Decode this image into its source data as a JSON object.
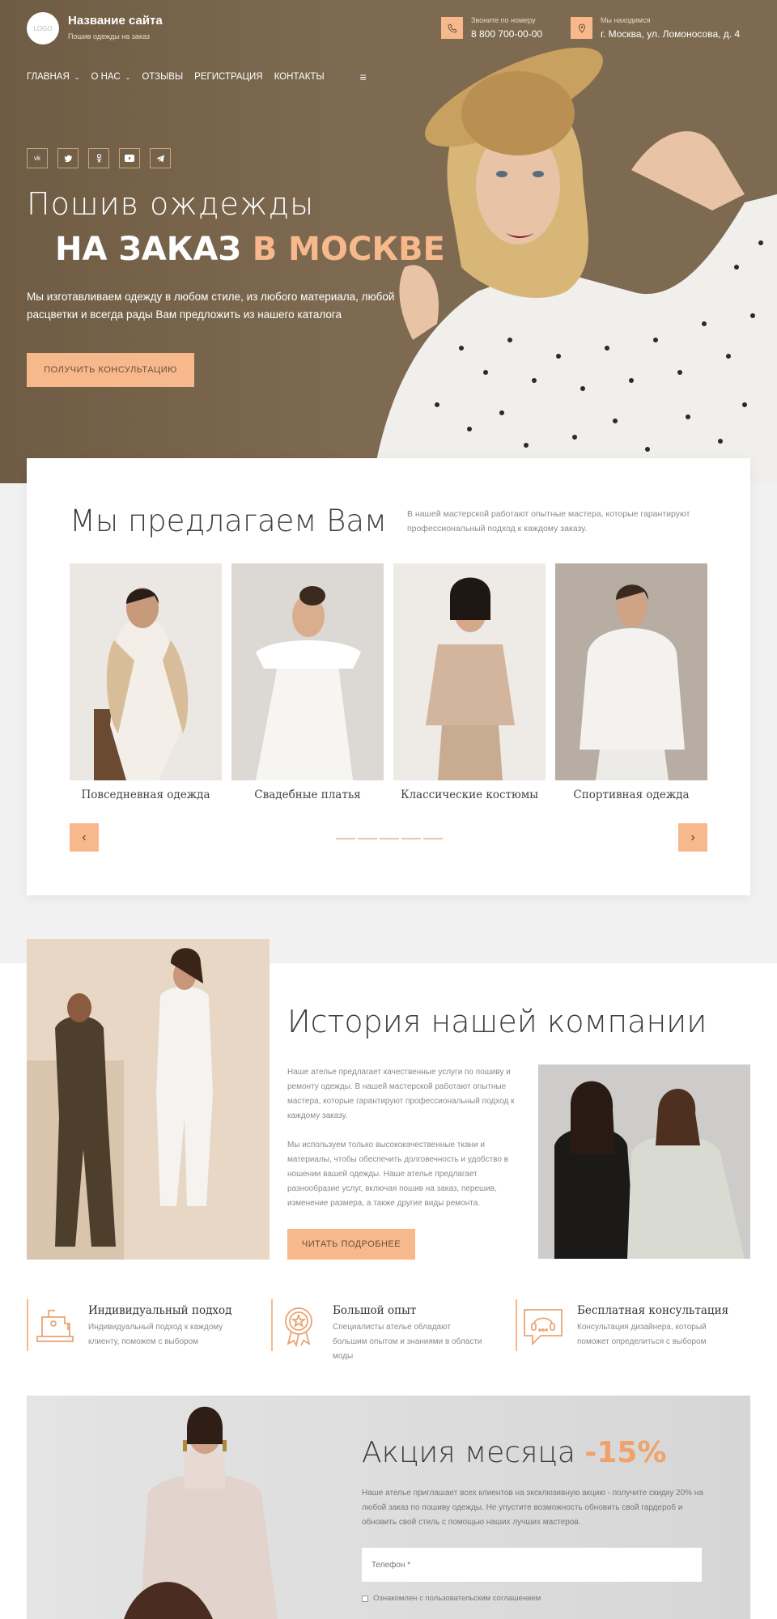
{
  "header": {
    "logo_text": "LOGO",
    "site_name": "Название сайта",
    "site_subtitle": "Пошив одежды на заказ",
    "phone_label": "Звоните по номеру",
    "phone": "8 800 700-00-00",
    "address_label": "Мы находимся",
    "address": "г. Москва, ул. Ломоносова, д. 4"
  },
  "nav": {
    "items": [
      {
        "label": "ГЛАВНАЯ",
        "dropdown": true
      },
      {
        "label": "О НАС",
        "dropdown": true
      },
      {
        "label": "ОТЗЫВЫ",
        "dropdown": false
      },
      {
        "label": "РЕГИСТРАЦИЯ",
        "dropdown": false
      },
      {
        "label": "КОНТАКТЫ",
        "dropdown": false
      }
    ],
    "menu_icon": "hamburger-icon"
  },
  "socials": [
    "VK",
    "Twitter",
    "Odnoklassniki",
    "YouTube",
    "Telegram"
  ],
  "hero": {
    "title_line1": "Пошив ождежды",
    "title_line2_a": "НА ЗАКАЗ",
    "title_line2_b": "В МОСКВЕ",
    "text": "Мы изготавливаем одежду в любом стиле, из любого материала, любой расцветки и всегда рады Вам предложить из нашего каталога",
    "button": "ПОЛУЧИТЬ КОНСУЛЬТАЦИЮ"
  },
  "offer": {
    "title": "Мы предлагаем Вам",
    "description": "В нашей мастерской работают опытные мастера, которые гарантируют профессиональный подход к каждому заказу.",
    "cards": [
      {
        "label": "Повседневная одежда"
      },
      {
        "label": "Свадебные платья"
      },
      {
        "label": "Классические костюмы"
      },
      {
        "label": "Спортивная одежда"
      }
    ],
    "slider_dots": 5
  },
  "history": {
    "title": "История нашей компании",
    "p1": "Наше ателье предлагает качественные услуги по пошиву и ремонту одежды. В нашей мастерской работают опытные мастера, которые гарантируют профессиональный подход к каждому заказу.",
    "p2": "Мы используем только высококачественные ткани и материалы, чтобы обеспечить долговечность и удобство в ношении вашей одежды. Наше ателье предлагает разнообразие услуг, включая пошив на заказ, перешив, изменение размера, а также другие виды ремонта.",
    "button": "ЧИТАТЬ ПОДРОБНЕЕ"
  },
  "features": [
    {
      "icon": "sewing-machine-icon",
      "title": "Индивидуальный подход",
      "text": "Индивидуальный подход к каждому клиенту, поможем с выбором"
    },
    {
      "icon": "award-badge-icon",
      "title": "Большой опыт",
      "text": "Специалисты ателье обладают большим опытом и знаниями в области моды"
    },
    {
      "icon": "consultation-chat-icon",
      "title": "Бесплатная консультация",
      "text": "Консультация дизайнера, который поможет определиться с выбором"
    }
  ],
  "promo": {
    "title": "Акция месяца",
    "discount": "-15%",
    "text": "Наше ателье приглашает всех клиентов на эксклюзивную акцию - получите скидку 20% на любой заказ по пошиву одежды. Не упустите возможность обновить свой гардероб и обновить свой стиль с помощью наших лучших мастеров.",
    "phone_placeholder": "Телефон *",
    "agree_label": "Ознакомлен с пользовательским соглашением"
  },
  "colors": {
    "accent": "#f7b98b",
    "hero_bg": "#7e6a50"
  }
}
